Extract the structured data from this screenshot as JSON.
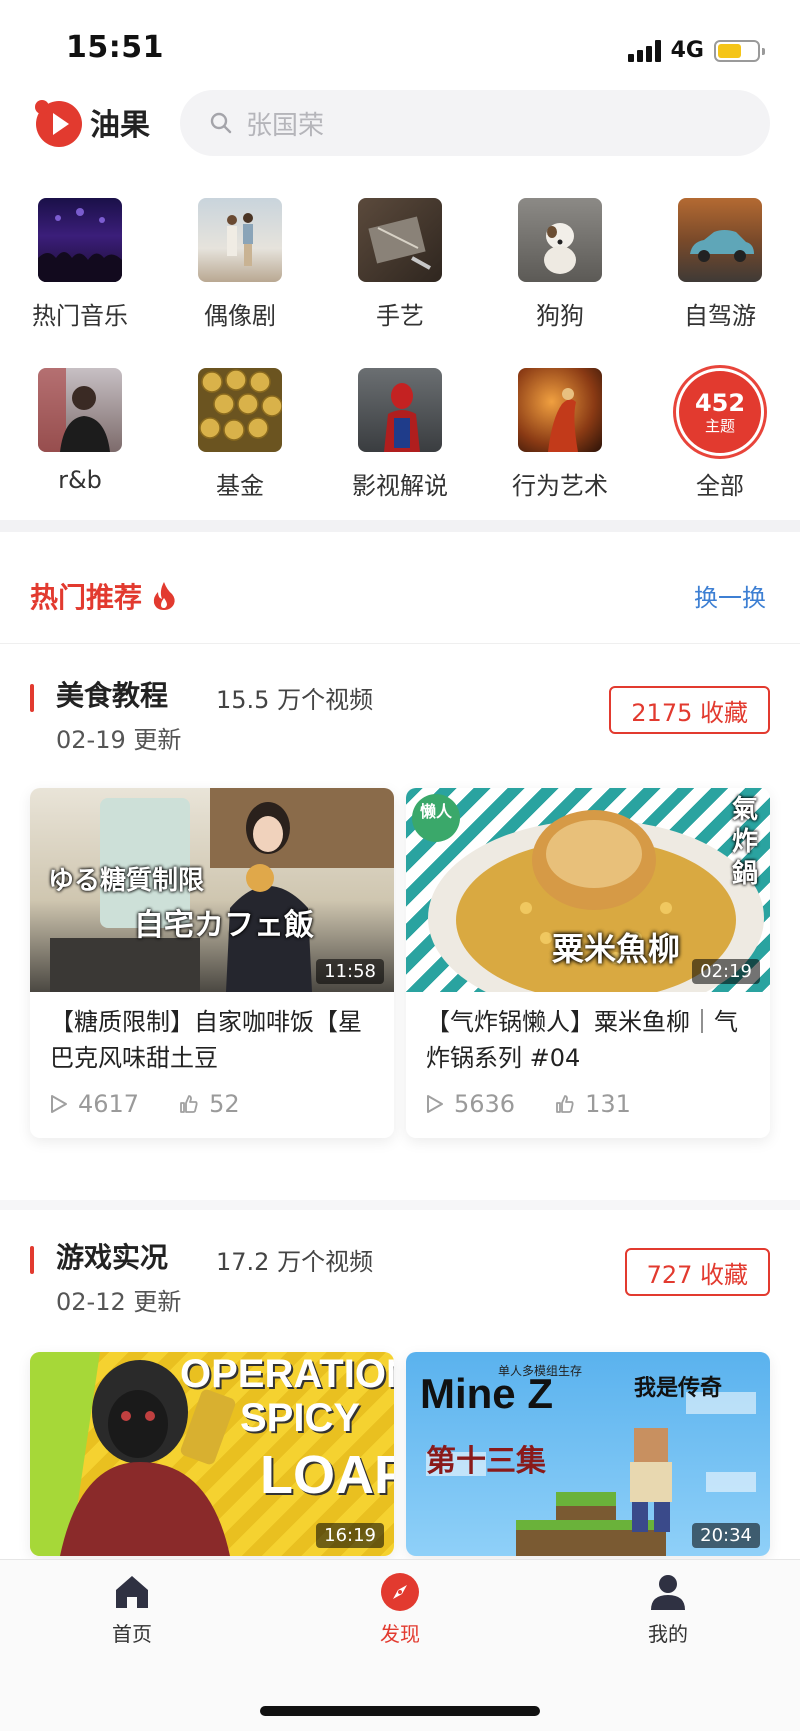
{
  "status_bar": {
    "time": "15:51",
    "network": "4G"
  },
  "header": {
    "app_name": "油果",
    "search_placeholder": "张国荣"
  },
  "categories": [
    {
      "label": "热门音乐",
      "icon": "concert-thumbnail"
    },
    {
      "label": "偶像剧",
      "icon": "couple-thumbnail"
    },
    {
      "label": "手艺",
      "icon": "craft-thumbnail"
    },
    {
      "label": "狗狗",
      "icon": "dog-thumbnail"
    },
    {
      "label": "自驾游",
      "icon": "car-thumbnail"
    },
    {
      "label": "r&b",
      "icon": "singer-thumbnail"
    },
    {
      "label": "基金",
      "icon": "coins-thumbnail"
    },
    {
      "label": "影视解说",
      "icon": "spiderman-thumbnail"
    },
    {
      "label": "行为艺术",
      "icon": "performer-thumbnail"
    },
    {
      "label": "全部",
      "badge_number": "452",
      "badge_sub": "主题"
    }
  ],
  "hot": {
    "title": "热门推荐",
    "refresh_label": "换一换"
  },
  "topics": [
    {
      "name": "美食教程",
      "video_count": "15.5 万个视频",
      "updated": "02-19 更新",
      "favorites": "2175 收藏",
      "videos": [
        {
          "title": "【糖质限制】自家咖啡饭【星巴克风味甜土豆",
          "duration": "11:58",
          "plays": "4617",
          "likes": "52",
          "overlay_text_1": "ゆる糖質制限",
          "overlay_text_2": "自宅カフェ飯"
        },
        {
          "title": "【气炸锅懒人】粟米鱼柳｜气炸锅系列 #04",
          "duration": "02:19",
          "plays": "5636",
          "likes": "131",
          "overlay_text_1": "氣炸鍋",
          "overlay_text_2": "粟米魚柳",
          "overlay_text_3": "懒人"
        }
      ]
    },
    {
      "name": "游戏实况",
      "video_count": "17.2 万个视频",
      "updated": "02-12 更新",
      "favorites": "727 收藏",
      "videos": [
        {
          "duration": "16:19",
          "overlay_text_1": "OPERATION",
          "overlay_text_2": "SPICY",
          "overlay_text_3": "LOAF"
        },
        {
          "duration": "20:34",
          "overlay_text_1": "Mine Z",
          "overlay_text_2": "第十三集",
          "overlay_text_3": "我是传奇",
          "overlay_text_4": "单人多模组生存"
        }
      ]
    }
  ],
  "bottom_nav": [
    {
      "label": "首页",
      "icon": "home-icon",
      "active": false
    },
    {
      "label": "发现",
      "icon": "compass-icon",
      "active": true
    },
    {
      "label": "我的",
      "icon": "user-icon",
      "active": false
    }
  ],
  "colors": {
    "accent": "#e23a2f",
    "link": "#3d7fd3"
  }
}
